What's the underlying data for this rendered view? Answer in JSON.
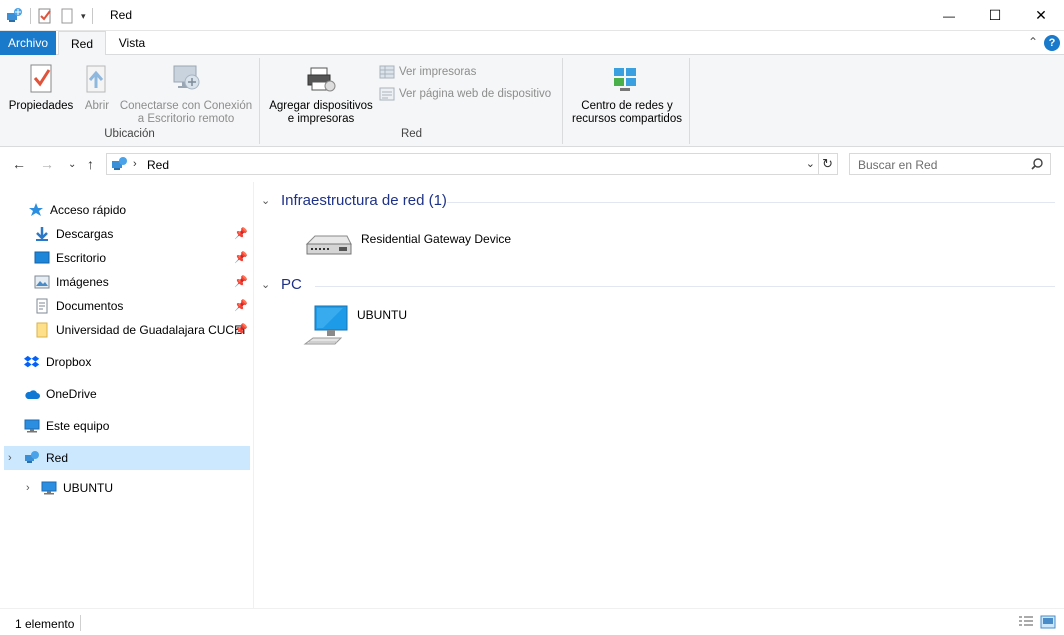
{
  "window": {
    "title": "Red",
    "minimize_glyph": "—",
    "maximize_glyph": "☐",
    "close_glyph": "✕"
  },
  "ribbon_tabs": {
    "file": "Archivo",
    "active": "Red",
    "view": "Vista"
  },
  "ribbon": {
    "groups": {
      "location": "Ubicación",
      "network": "Red"
    },
    "buttons": {
      "properties": "Propiedades",
      "open": "Abrir",
      "remote_line1": "Conectarse con Conexión",
      "remote_line2": "a Escritorio remoto",
      "add_devices_line1": "Agregar dispositivos",
      "add_devices_line2": "e impresoras",
      "view_printers": "Ver impresoras",
      "view_device_page": "Ver página web de dispositivo",
      "network_center_line1": "Centro de redes y",
      "network_center_line2": "recursos compartidos"
    }
  },
  "address": {
    "crumb": "Red",
    "search_placeholder": "Buscar en Red"
  },
  "sidebar": {
    "quick_access": "Acceso rápido",
    "items": [
      {
        "label": "Descargas"
      },
      {
        "label": "Escritorio"
      },
      {
        "label": "Imágenes"
      },
      {
        "label": "Documentos"
      },
      {
        "label": "Universidad de Guadalajara CUCEI"
      }
    ],
    "dropbox": "Dropbox",
    "onedrive": "OneDrive",
    "this_pc": "Este equipo",
    "network": "Red",
    "network_child": "UBUNTU"
  },
  "content": {
    "group1": {
      "title": "Infraestructura de red (1)",
      "items": [
        {
          "label": "Residential Gateway Device"
        }
      ]
    },
    "group2": {
      "title": "PC",
      "items": [
        {
          "label": "UBUNTU"
        }
      ]
    }
  },
  "status": {
    "count": "1 elemento"
  },
  "colors": {
    "accent": "#1979ca",
    "selection": "#cce8ff",
    "group_header": "#1e3287"
  }
}
